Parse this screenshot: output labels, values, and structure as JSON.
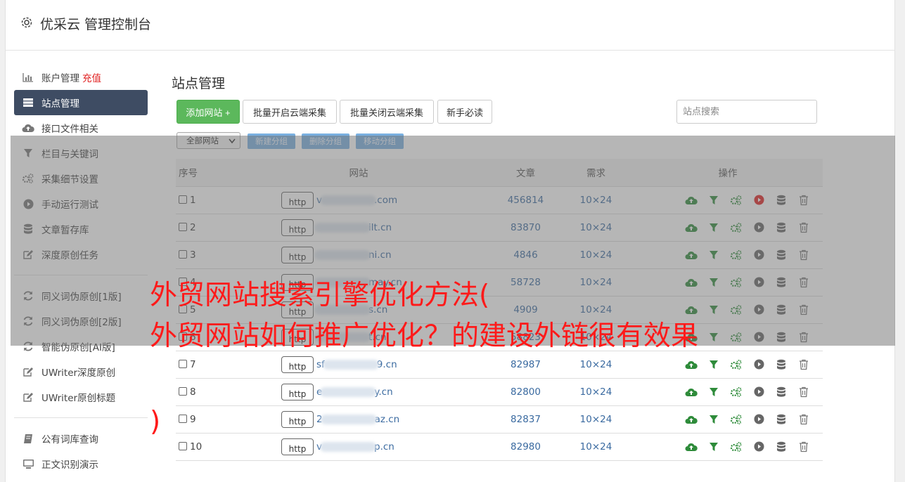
{
  "app": {
    "title": "优采云 管理控制台"
  },
  "sidebar": {
    "groups": [
      [
        {
          "label": "账户管理",
          "badge": "充值",
          "icon": "bar-chart-icon"
        },
        {
          "label": "站点管理",
          "icon": "server-icon",
          "active": true
        },
        {
          "label": "接口文件相关",
          "icon": "cloud-upload-icon"
        },
        {
          "label": "栏目与关键词",
          "icon": "filter-icon"
        },
        {
          "label": "采集细节设置",
          "icon": "gears-icon"
        },
        {
          "label": "手动运行测试",
          "icon": "play-circle-icon"
        },
        {
          "label": "文章暂存库",
          "icon": "database-icon"
        },
        {
          "label": "深度原创任务",
          "icon": "edit-icon"
        }
      ],
      [
        {
          "label": "同义词伪原创[1版]",
          "icon": "refresh-icon"
        },
        {
          "label": "同义词伪原创[2版]",
          "icon": "refresh-icon"
        },
        {
          "label": "智能伪原创[AI版]",
          "icon": "refresh-icon"
        },
        {
          "label": "UWriter深度原创",
          "icon": "edit-icon"
        },
        {
          "label": "UWriter原创标题",
          "icon": "edit-icon"
        }
      ],
      [
        {
          "label": "公有词库查询",
          "icon": "book-icon"
        },
        {
          "label": "正文识别演示",
          "icon": "monitor-icon"
        }
      ]
    ]
  },
  "main": {
    "page_title": "站点管理",
    "toolbar": {
      "add_site": "添加网站 +",
      "batch_enable": "批量开启云端采集",
      "batch_disable": "批量关闭云端采集",
      "beginner": "新手必读"
    },
    "search": {
      "placeholder": "站点搜索"
    },
    "group": {
      "select_value": "全部网站",
      "new_group": "新建分组",
      "delete_group": "删除分组",
      "move_group": "移动分组"
    },
    "table": {
      "headers": {
        "num": "序号",
        "site": "网站",
        "articles": "文章",
        "demand": "需求",
        "ops": "操作"
      },
      "rows": [
        {
          "num": "1",
          "prefix": "http",
          "pre": "v",
          "post": ".com",
          "articles": "456814",
          "demand": "10×24",
          "active": true
        },
        {
          "num": "2",
          "prefix": "http",
          "pre": "",
          "post": "ilt.cn",
          "articles": "83870",
          "demand": "10×24",
          "active": false
        },
        {
          "num": "3",
          "prefix": "http",
          "pre": "",
          "post": "ni.cn",
          "articles": "4846",
          "demand": "10×24",
          "active": false
        },
        {
          "num": "4",
          "prefix": "http",
          "pre": "",
          "post": "may.cn",
          "articles": "58728",
          "demand": "10×24",
          "active": false
        },
        {
          "num": "5",
          "prefix": "http",
          "pre": "",
          "post": "s.cn",
          "articles": "4909",
          "demand": "10×24",
          "active": false
        },
        {
          "num": "6",
          "prefix": "http",
          "pre": "",
          "post": "t.cn",
          "articles": "58823",
          "demand": "10×24",
          "active": false
        },
        {
          "num": "7",
          "prefix": "http",
          "pre": "sf",
          "post": "9.cn",
          "articles": "82987",
          "demand": "10×24",
          "active": false
        },
        {
          "num": "8",
          "prefix": "http",
          "pre": "e",
          "post": "y.cn",
          "articles": "82800",
          "demand": "10×24",
          "active": false
        },
        {
          "num": "9",
          "prefix": "http",
          "pre": "2",
          "post": "az.cn",
          "articles": "82837",
          "demand": "10×24",
          "active": false
        },
        {
          "num": "10",
          "prefix": "http",
          "pre": "v",
          "post": "p.cn",
          "articles": "82980",
          "demand": "10×24",
          "active": false
        }
      ]
    }
  },
  "overlay": {
    "headline_lines": [
      "外贸网站搜索引擎优化方法(",
      "外贸网站如何推广优化？的建设外链很有效果",
      ")"
    ]
  },
  "colors": {
    "accent_green": "#5cb85c",
    "sidebar_active": "#3e4c63",
    "link_blue": "#3a6aa0",
    "headline_red": "#ff1a1a",
    "run_red": "#e02020"
  }
}
